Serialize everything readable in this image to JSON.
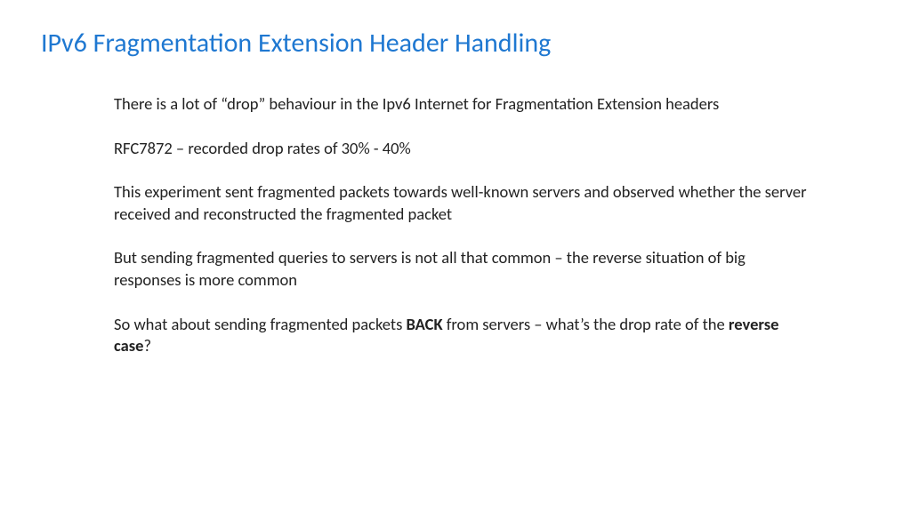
{
  "title": "IPv6 Fragmentation Extension Header Handling",
  "p1": "There is a lot of “drop” behaviour in the Ipv6 Internet for Fragmentation Extension headers",
  "p2": "RFC7872 – recorded drop rates of 30% - 40%",
  "p3": "This experiment sent fragmented packets towards well-known servers and observed whether the server received and reconstructed the fragmented packet",
  "p4": "But sending fragmented queries to servers is not all that common – the reverse situation of big responses is more common",
  "p5a": "So what about sending fragmented packets ",
  "p5b": "BACK",
  "p5c": " from servers – what’s the drop rate of the ",
  "p5d": "reverse case",
  "p5e": "?"
}
